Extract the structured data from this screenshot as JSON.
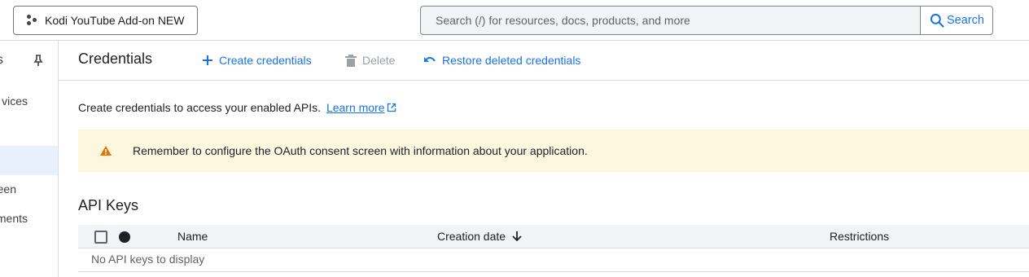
{
  "topbar": {
    "project_name": "Kodi YouTube Add-on NEW",
    "search_placeholder": "Search (/) for resources, docs, products, and more",
    "search_button": "Search"
  },
  "sidebar": {
    "header_fragment": "s",
    "items": [
      {
        "label": "vices",
        "active": false
      },
      {
        "label": "",
        "active": true
      },
      {
        "label": "een",
        "active": false
      },
      {
        "label": "ments",
        "active": false
      }
    ]
  },
  "toolbar": {
    "title": "Credentials",
    "create_label": "Create credentials",
    "delete_label": "Delete",
    "restore_label": "Restore deleted credentials"
  },
  "intro": {
    "text": "Create credentials to access your enabled APIs.",
    "link": "Learn more"
  },
  "banner": {
    "text": "Remember to configure the OAuth consent screen with information about your application."
  },
  "api_keys": {
    "title": "API Keys",
    "columns": [
      "Name",
      "Creation date",
      "Restrictions"
    ],
    "empty_text": "No API keys to display"
  },
  "colors": {
    "accent": "#1a73e8",
    "warning_bg": "#fef7e0",
    "warning_icon": "#e37400",
    "disabled": "#9aa0a6"
  }
}
